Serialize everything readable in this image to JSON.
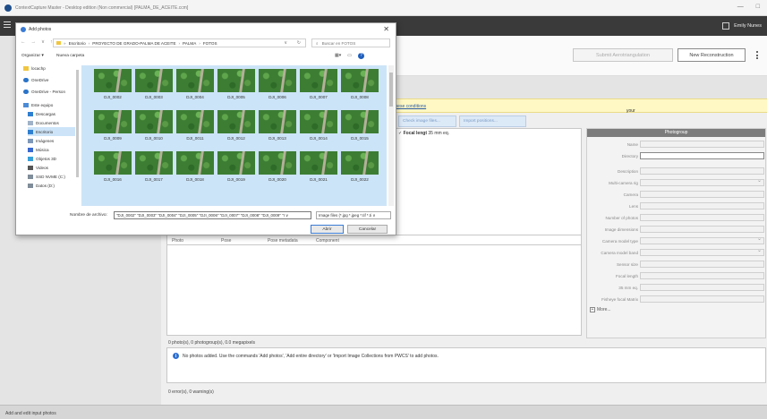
{
  "os_window": {
    "title": "ContextCapture Master - Desktop edition (Non commercial) [PALMA_DE_ACEITE.ccm]",
    "controls": [
      "—",
      "□"
    ]
  },
  "header": {
    "user_name": "Emily Nunes"
  },
  "toolbar": {
    "aerotriangulation_label": "Submit Aerotriangulation",
    "new_reconstruction_label": "New Reconstruction"
  },
  "notice": {
    "prefix": "your input data fulfill ",
    "link": "these conditions",
    "suffix": "."
  },
  "photo_actions": {
    "check_files_label": "Check image files...",
    "import_positions_label": "Import positions..."
  },
  "focal": {
    "label": "Focal lengt",
    "value": "35 mm eq."
  },
  "photos_table": {
    "columns": [
      "Photo",
      "Pose",
      "Pose metadata",
      "Component"
    ]
  },
  "summary": "0 photo(s), 0 photogroup(s), 0.0 megapixels",
  "info_message": "No photos added. Use the commands 'Add photos', 'Add entire directory' or 'Import Image Collections from PWCS' to add photos.",
  "errors_text": "0 error(s), 0 warning(s)",
  "status_bar": "Add and edit input photos",
  "photogroup_panel": {
    "title": "Photogroup",
    "fields": [
      {
        "label": "Name"
      },
      {
        "label": "Directory"
      },
      {
        "label": "Description"
      },
      {
        "label": "Multi-camera rig"
      },
      {
        "label": "Camera"
      },
      {
        "label": "Lens"
      },
      {
        "label": "Number of photos"
      },
      {
        "label": "Image dimensions"
      },
      {
        "label": "Camera model type"
      },
      {
        "label": "Camera model band"
      },
      {
        "label": "Sensor size"
      },
      {
        "label": "Focal length"
      },
      {
        "label": "35 mm eq."
      },
      {
        "label": "Fisheye focal Matrix"
      }
    ],
    "more_label": "More..."
  },
  "dialog": {
    "title": "Add photos",
    "nav_arrows": [
      "←",
      "→",
      "∨",
      "↑"
    ],
    "breadcrumb": [
      "Escritorio",
      "PROYECTO DE GRADO-PALMA DE ACEITE",
      "PALMA",
      "FOTOS"
    ],
    "search_placeholder": "Buscar en FOTOS",
    "organize_label": "Organizar ▾",
    "new_folder_label": "Nueva carpeta",
    "nav_items": [
      {
        "label": "locachp",
        "icon": "folder-icon",
        "color": "#f0c640"
      },
      {
        "label": "OneDrive",
        "icon": "cloud-icon",
        "color": "#2a74c9"
      },
      {
        "label": "OneDrive - Person",
        "icon": "cloud-icon",
        "color": "#2a74c9"
      },
      {
        "label": "Este equipo",
        "icon": "computer-icon",
        "color": "#4b8bd6"
      },
      {
        "label": "Descargas",
        "icon": "download-icon",
        "color": "#2f7fd0"
      },
      {
        "label": "Documentos",
        "icon": "documents-icon",
        "color": "#9fb2c8"
      },
      {
        "label": "Escritorio",
        "icon": "desktop-icon",
        "color": "#2f7fd0"
      },
      {
        "label": "Imágenes",
        "icon": "images-icon",
        "color": "#7d98b8"
      },
      {
        "label": "Música",
        "icon": "music-icon",
        "color": "#3a6ad0"
      },
      {
        "label": "Objetos 3D",
        "icon": "objects-3d-icon",
        "color": "#38a0d8"
      },
      {
        "label": "Videos",
        "icon": "videos-icon",
        "color": "#555555"
      },
      {
        "label": "SSD NVME (C:)",
        "icon": "drive-icon",
        "color": "#7f8c99"
      },
      {
        "label": "Datos (D:)",
        "icon": "drive-icon",
        "color": "#7f8c99"
      }
    ],
    "photos": [
      "DJI_0002",
      "DJI_0003",
      "DJI_0004",
      "DJI_0005",
      "DJI_0006",
      "DJI_0007",
      "DJI_0008",
      "DJI_0009",
      "DJI_0010",
      "DJI_0011",
      "DJI_0012",
      "DJI_0013",
      "DJI_0014",
      "DJI_0015",
      "DJI_0016",
      "DJI_0017",
      "DJI_0018",
      "DJI_0019",
      "DJI_0020",
      "DJI_0021",
      "DJI_0022"
    ],
    "filename_label": "Nombre de archivo:",
    "filename_value": "\"DJI_0002\" \"DJI_0003\" \"DJI_0004\" \"DJI_0005\" \"DJI_0006\" \"DJI_0007\" \"DJI_0008\" \"DJI_0009\" \"I ∨",
    "filetype_value": "Image files (*.jpg *.jpeg *.tif *.ti ∨",
    "open_label": "Abrir",
    "cancel_label": "Cancelar"
  }
}
